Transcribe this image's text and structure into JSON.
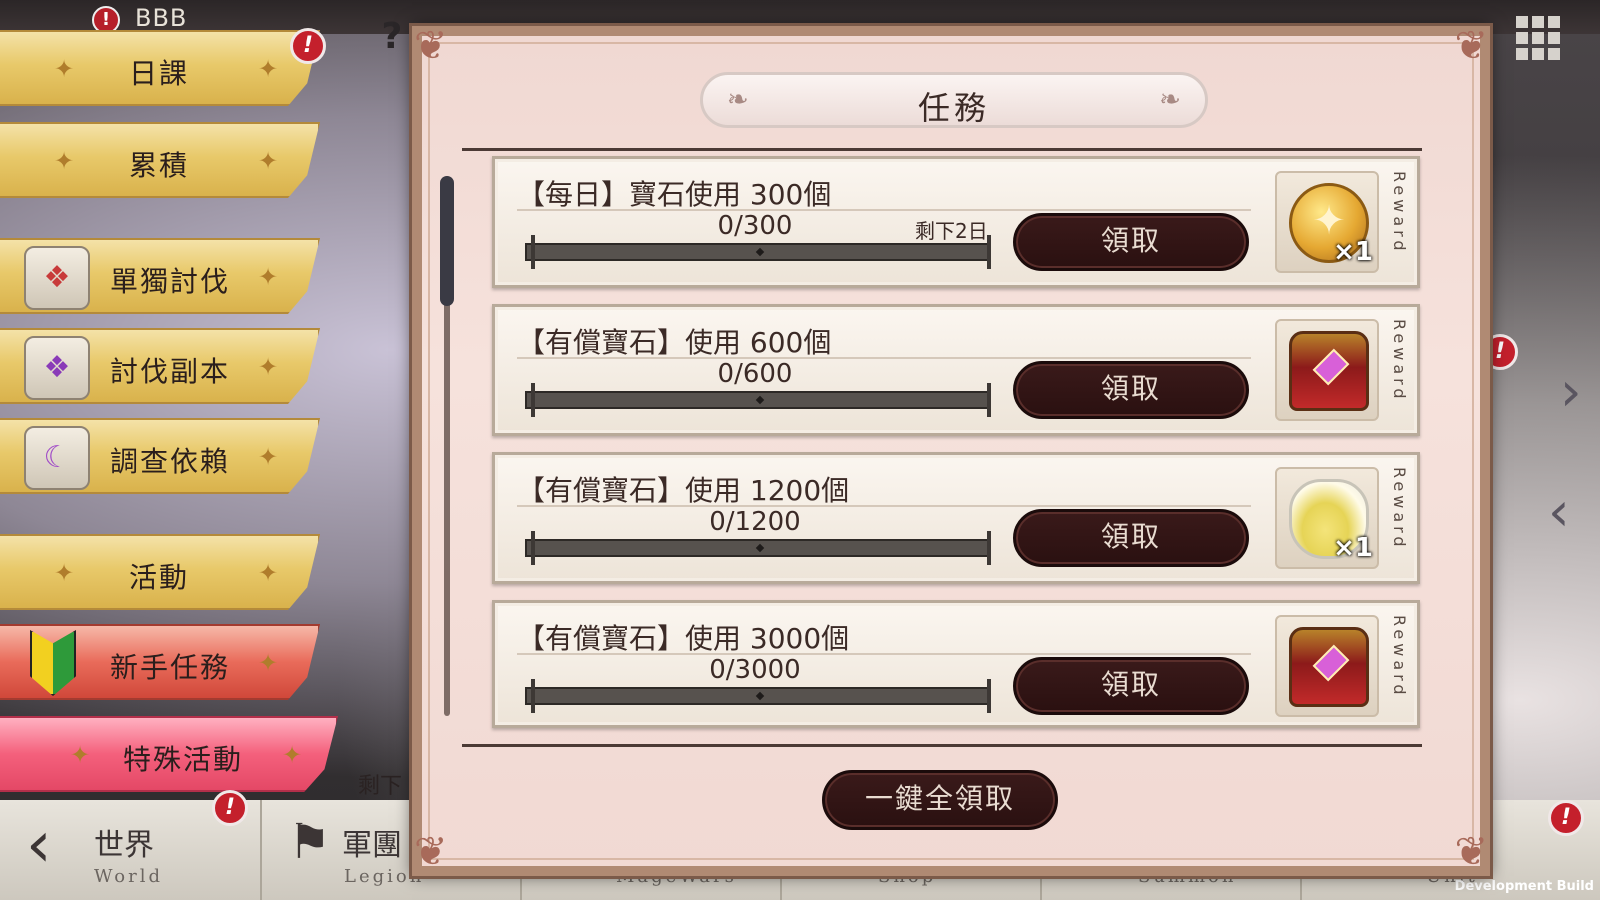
{
  "header": {
    "username": "BBB",
    "user_alert": "!",
    "help_icon": "?"
  },
  "menu": {
    "items": [
      {
        "label": "日課",
        "alert": "!"
      },
      {
        "label": "累積"
      },
      {
        "label": "單獨討伐"
      },
      {
        "label": "討伐副本"
      },
      {
        "label": "調查依賴"
      },
      {
        "label": "活動"
      },
      {
        "label": "新手任務"
      },
      {
        "label": "特殊活動"
      }
    ],
    "remain_text": "剩下"
  },
  "dialog": {
    "title": "任務",
    "quests": [
      {
        "title": "【每日】寶石使用 300個",
        "progress": "0/300",
        "current": 0,
        "target": 300,
        "remain": "剩下2日",
        "claim_label": "領取",
        "reward_icon": "gold-medal-icon",
        "reward_qty": "×1"
      },
      {
        "title": "【有償寶石】使用 600個",
        "progress": "0/600",
        "current": 0,
        "target": 600,
        "remain": "",
        "claim_label": "領取",
        "reward_icon": "treasure-chest-icon",
        "reward_qty": ""
      },
      {
        "title": "【有償寶石】使用 1200個",
        "progress": "0/1200",
        "current": 0,
        "target": 1200,
        "remain": "",
        "claim_label": "領取",
        "reward_icon": "potion-jug-icon",
        "reward_qty": "×1"
      },
      {
        "title": "【有償寶石】使用 3000個",
        "progress": "0/3000",
        "current": 0,
        "target": 3000,
        "remain": "",
        "claim_label": "領取",
        "reward_icon": "treasure-chest-icon",
        "reward_qty": ""
      }
    ],
    "reward_label": "Reward",
    "claim_all_label": "一鍵全領取"
  },
  "bottom_nav": {
    "tabs": [
      {
        "zh": "世界",
        "en": "World"
      },
      {
        "zh": "軍團",
        "en": "Legion"
      },
      {
        "zh": "",
        "en": "MageWars"
      },
      {
        "zh": "",
        "en": "Shop"
      },
      {
        "zh": "",
        "en": "Summon"
      },
      {
        "zh": "",
        "en": "Unit"
      }
    ],
    "back_icon": "‹",
    "dev_build": "Development Build"
  },
  "colors": {
    "dialog_bg": "#f0d8d2",
    "button_dark": "#2a1010",
    "menu_gold": "#e8c96a",
    "menu_pink": "#f4607c",
    "alert_red": "#c4202c"
  }
}
